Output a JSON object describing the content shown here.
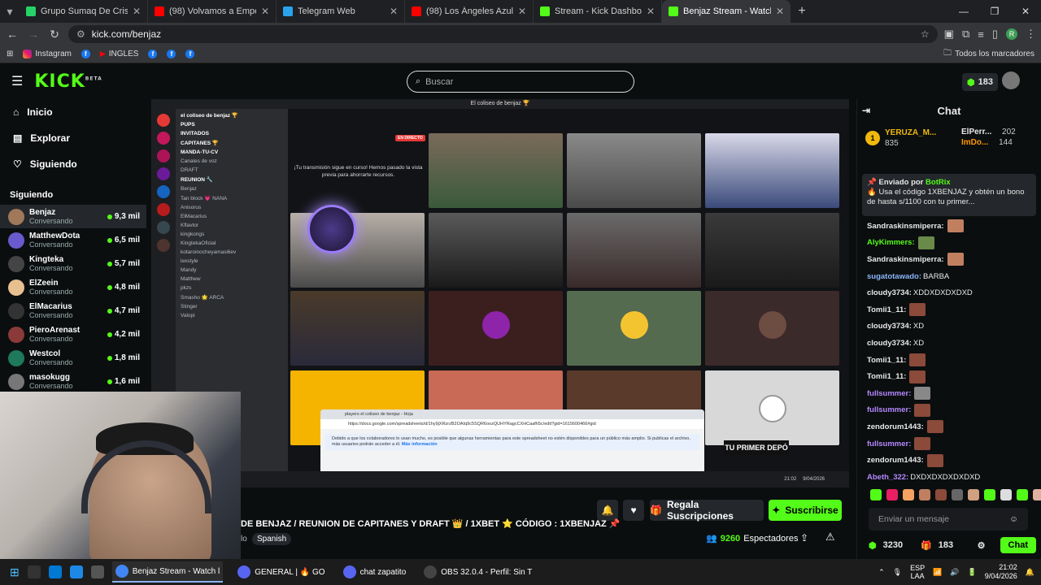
{
  "browser": {
    "tabs": [
      {
        "title": "Grupo Sumaq De Crispín Alegr",
        "color": "#25d366"
      },
      {
        "title": "(98) Volvamos a Empezar - You",
        "color": "#ff0000"
      },
      {
        "title": "Telegram Web",
        "color": "#2aa3ef"
      },
      {
        "title": "(98) Los Ángeles Azules - Nunc",
        "color": "#ff0000"
      },
      {
        "title": "Stream - Kick Dashboard",
        "color": "#53fc18"
      },
      {
        "title": "Benjaz Stream - Watch Live",
        "color": "#53fc18"
      }
    ],
    "url": "kick.com/benjaz",
    "bookmarks": [
      "Instagram",
      "INGLES"
    ],
    "all_bookmarks": "Todos los marcadores",
    "profile_letter": "R"
  },
  "kick": {
    "logo": "KICK",
    "logo_sup": "BETA",
    "search_placeholder": "Buscar",
    "coins": "183",
    "nav": [
      "Inicio",
      "Explorar",
      "Siguiendo"
    ],
    "following_title": "Siguiendo",
    "channels": [
      {
        "name": "Benjaz",
        "status": "Conversando",
        "viewers": "9,3 mil",
        "color": "#a0785a"
      },
      {
        "name": "MatthewDota",
        "status": "Conversando",
        "viewers": "6,5 mil",
        "color": "#6a5acd"
      },
      {
        "name": "Kingteka",
        "status": "Conversando",
        "viewers": "5,7 mil",
        "color": "#444"
      },
      {
        "name": "ElZeein",
        "status": "Conversando",
        "viewers": "4,8 mil",
        "color": "#e8c090"
      },
      {
        "name": "ElMacarius",
        "status": "Conversando",
        "viewers": "4,7 mil",
        "color": "#333"
      },
      {
        "name": "PieroArenast",
        "status": "Conversando",
        "viewers": "4,2 mil",
        "color": "#8b3a3a"
      },
      {
        "name": "Westcol",
        "status": "Conversando",
        "viewers": "1,8 mil",
        "color": "#1e7a5a"
      },
      {
        "name": "masokugg",
        "status": "Conversando",
        "viewers": "1,6 mil",
        "color": "#777"
      }
    ]
  },
  "stream": {
    "discord_title": "El coliseo de benjaz 🏆",
    "discord_server": "el coliseo de benjaz 🏆",
    "discord_channels": [
      "PUPS",
      "INVITADOS",
      "CAPITANES 🏆",
      "MANDA-TU-CV",
      "Canales de voz",
      "DRAFT",
      "REUNION 🔧",
      "Benjaz",
      "Tan block 💗 NANA",
      "Anisorus",
      "ElMacarius",
      "Kflavtor",
      "kingkongs",
      "KingtekaOficial",
      "kotaroinocheyamasi6ev",
      "lexstyle",
      "Mandy",
      "Matthew",
      "pkzs",
      "Smasho 🌟 ARCA",
      "Stinger",
      "Valopi"
    ],
    "live_badge": "EN DIRECTO",
    "transmit_note": "¡Tu transmisión sigue en curso! Hemos pasado la vista previa para ahorrarte recursos.",
    "popup_tab": "players el coliseo de benjaz - Hoja",
    "popup_url": "https://docs.google.com/spreadsheets/d/1hy9jXRzrzB2OAIq9c5SQR6oozQUHYRagcCXHCaafh5c/edit?gid=1615600466#gid",
    "popup_warning": "Debido a que los colaboradores lo usan mucho, es posible que algunas herramientas para este spreadsheet no estén disponibles para un público más amplio. Si publicas el archivo, más usuarios podrán acceder a él.",
    "popup_more": "Más información",
    "promo": "TU PRIMER DEPÓ",
    "mini_clock_time": "21:02",
    "mini_clock_date": "9/04/2026"
  },
  "info": {
    "title": "DE BENJAZ / REUNION DE CAPITANES Y DRAFT 👑 / 1XBET ⭐ CÓDIGO : 1XBENJAZ 📌",
    "lang_prefix": "lo",
    "language": "Spanish",
    "gift_label": "Regala Suscripciones",
    "subscribe_label": "Suscribirse",
    "viewers": "9260",
    "viewers_label": "Espectadores"
  },
  "chat": {
    "title": "Chat",
    "leaders": [
      {
        "rank": "1",
        "name": "YERUZA_M...",
        "count": "835"
      },
      {
        "name": "ElPerr...",
        "count": "202"
      },
      {
        "name": "ImDo...",
        "count": "144"
      }
    ],
    "pinned_by": "Enviado por",
    "pinned_user": "BotRix",
    "pinned_text": "🔥 Usa el código 1XBENJAZ y obtén un bono de hasta s/1100 con tu primer...",
    "messages": [
      {
        "user": "Sandraskinsmiperra:",
        "text": "",
        "color": "#e8e8e8",
        "emote": "#c08060"
      },
      {
        "user": "AlyKimmers:",
        "text": "",
        "color": "#53fc18",
        "emote": "#6a8a4a"
      },
      {
        "user": "Sandraskinsmiperra:",
        "text": "",
        "color": "#e8e8e8",
        "emote": "#c08060"
      },
      {
        "user": "sugatotawado:",
        "text": "BARBA",
        "color": "#8ab4f8",
        "emote": ""
      },
      {
        "user": "cloudy3734:",
        "text": "XDDXDXDXDXD",
        "color": "#e8e8e8",
        "emote": ""
      },
      {
        "user": "Tomii1_11:",
        "text": "",
        "color": "#e8e8e8",
        "emote": "#8b4a3a"
      },
      {
        "user": "cloudy3734:",
        "text": "XD",
        "color": "#e8e8e8",
        "emote": ""
      },
      {
        "user": "cloudy3734:",
        "text": "XD",
        "color": "#e8e8e8",
        "emote": ""
      },
      {
        "user": "Tomii1_11:",
        "text": "",
        "color": "#e8e8e8",
        "emote": "#8b4a3a"
      },
      {
        "user": "Tomii1_11:",
        "text": "",
        "color": "#e8e8e8",
        "emote": "#8b4a3a"
      },
      {
        "user": "fullsummer:",
        "text": "",
        "color": "#b388ff",
        "emote": "#888"
      },
      {
        "user": "fullsummer:",
        "text": "",
        "color": "#b388ff",
        "emote": "#8b4a3a"
      },
      {
        "user": "zendorum1443:",
        "text": "",
        "color": "#e8e8e8",
        "emote": "#8b4a3a"
      },
      {
        "user": "fullsummer:",
        "text": "",
        "color": "#b388ff",
        "emote": "#8b4a3a"
      },
      {
        "user": "zendorum1443:",
        "text": "",
        "color": "#e8e8e8",
        "emote": "#8b4a3a"
      },
      {
        "user": "Abeth_322:",
        "text": "DXDXDXDXDXDXD",
        "color": "#b388ff",
        "emote": ""
      }
    ],
    "input_placeholder": "Enviar un mensaje",
    "points": "3230",
    "gifts": "183",
    "send_label": "Chat"
  },
  "taskbar": {
    "apps": [
      {
        "label": "Benjaz Stream - Watch l",
        "active": true
      },
      {
        "label": "GENERAL | 🔥 GO",
        "active": false
      },
      {
        "label": "chat zapatito",
        "active": false
      },
      {
        "label": "OBS 32.0.4 - Perfil: Sin T",
        "active": false
      }
    ],
    "lang": "ESP",
    "lang2": "LAA",
    "time": "21:02",
    "date": "9/04/2026"
  },
  "colors": {
    "accent": "#53fc18",
    "bg": "#0b0e0f"
  }
}
